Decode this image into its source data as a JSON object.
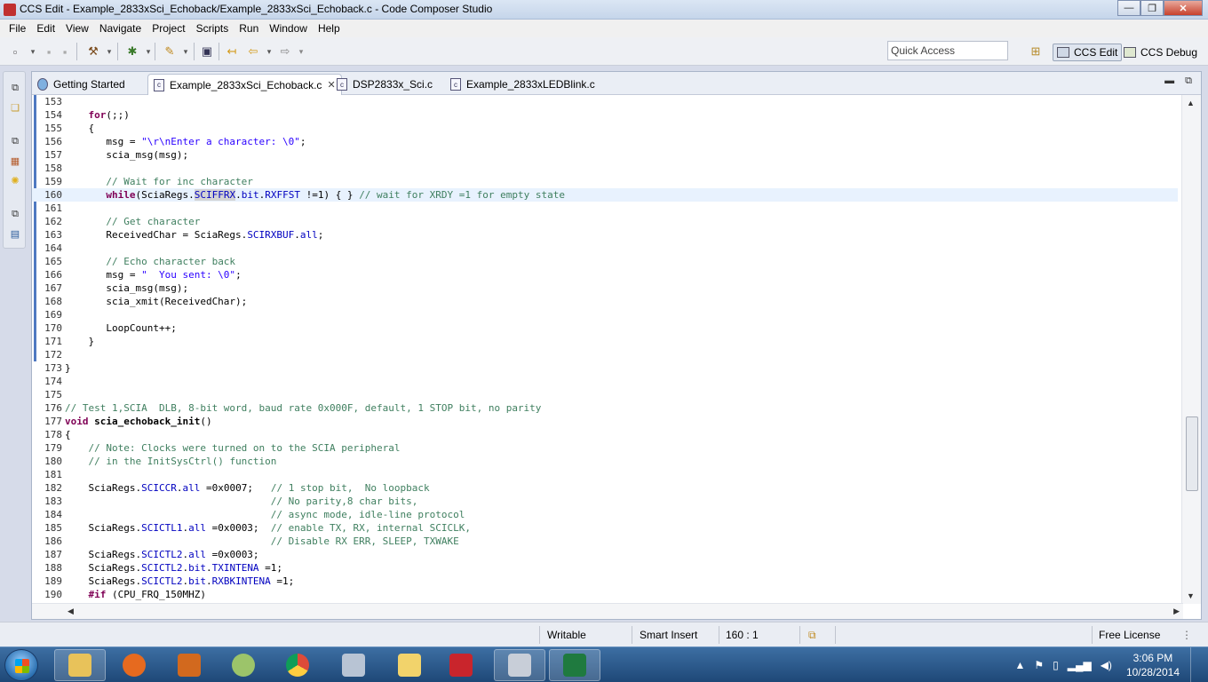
{
  "window": {
    "title": "CCS Edit - Example_2833xSci_Echoback/Example_2833xSci_Echoback.c - Code Composer Studio",
    "minimize": "—",
    "maximize": "❐",
    "close": "✕"
  },
  "menu": [
    "File",
    "Edit",
    "View",
    "Navigate",
    "Project",
    "Scripts",
    "Run",
    "Window",
    "Help"
  ],
  "toolbar": {
    "quick_access_placeholder": "Quick Access",
    "perspectives": [
      {
        "label": "CCS Edit",
        "active": true
      },
      {
        "label": "CCS Debug",
        "active": false
      }
    ]
  },
  "editor": {
    "tabs": [
      {
        "label": "Getting Started",
        "icon": "globe-icon",
        "active": false
      },
      {
        "label": "Example_2833xSci_Echoback.c",
        "icon": "c-file-icon",
        "active": true,
        "closable": true
      },
      {
        "label": "DSP2833x_Sci.c",
        "icon": "c-file-icon",
        "active": false
      },
      {
        "label": "Example_2833xLEDBlink.c",
        "icon": "c-file-icon",
        "active": false
      }
    ],
    "current_line": 160,
    "lines": [
      {
        "n": "153",
        "segs": [
          [
            "",
            ""
          ]
        ]
      },
      {
        "n": "154",
        "segs": [
          [
            "",
            "    "
          ],
          [
            "kw",
            "for"
          ],
          [
            "",
            "(;;)"
          ]
        ]
      },
      {
        "n": "155",
        "segs": [
          [
            "",
            "    {"
          ]
        ]
      },
      {
        "n": "156",
        "segs": [
          [
            "",
            "       msg = "
          ],
          [
            "st",
            "\"\\r\\nEnter a character: \\0\""
          ],
          [
            "",
            ";"
          ]
        ]
      },
      {
        "n": "157",
        "segs": [
          [
            "",
            "       scia_msg(msg);"
          ]
        ]
      },
      {
        "n": "158",
        "segs": [
          [
            "",
            ""
          ]
        ]
      },
      {
        "n": "159",
        "segs": [
          [
            "",
            "       "
          ],
          [
            "cm",
            "// Wait for inc character"
          ]
        ]
      },
      {
        "n": "160",
        "segs": [
          [
            "",
            "       "
          ],
          [
            "kw",
            "while"
          ],
          [
            "",
            "(SciaRegs."
          ],
          [
            "fd hl",
            "SCIFFRX"
          ],
          [
            "",
            "."
          ],
          [
            "fd",
            "bit"
          ],
          [
            "",
            "."
          ],
          [
            "fd",
            "RXFFST"
          ],
          [
            "",
            " !=1) { } "
          ],
          [
            "cm",
            "// wait for XRDY =1 for empty state"
          ]
        ]
      },
      {
        "n": "161",
        "segs": [
          [
            "",
            ""
          ]
        ]
      },
      {
        "n": "162",
        "segs": [
          [
            "",
            "       "
          ],
          [
            "cm",
            "// Get character"
          ]
        ]
      },
      {
        "n": "163",
        "segs": [
          [
            "",
            "       ReceivedChar = SciaRegs."
          ],
          [
            "fd",
            "SCIRXBUF"
          ],
          [
            "",
            "."
          ],
          [
            "fd",
            "all"
          ],
          [
            "",
            ";"
          ]
        ]
      },
      {
        "n": "164",
        "segs": [
          [
            "",
            ""
          ]
        ]
      },
      {
        "n": "165",
        "segs": [
          [
            "",
            "       "
          ],
          [
            "cm",
            "// Echo character back"
          ]
        ]
      },
      {
        "n": "166",
        "segs": [
          [
            "",
            "       msg = "
          ],
          [
            "st",
            "\"  You sent: \\0\""
          ],
          [
            "",
            ";"
          ]
        ]
      },
      {
        "n": "167",
        "segs": [
          [
            "",
            "       scia_msg(msg);"
          ]
        ]
      },
      {
        "n": "168",
        "segs": [
          [
            "",
            "       scia_xmit(ReceivedChar);"
          ]
        ]
      },
      {
        "n": "169",
        "segs": [
          [
            "",
            ""
          ]
        ]
      },
      {
        "n": "170",
        "segs": [
          [
            "",
            "       LoopCount++;"
          ]
        ]
      },
      {
        "n": "171",
        "segs": [
          [
            "",
            "    }"
          ]
        ]
      },
      {
        "n": "172",
        "segs": [
          [
            "",
            ""
          ]
        ]
      },
      {
        "n": "173",
        "segs": [
          [
            "",
            "}"
          ]
        ]
      },
      {
        "n": "174",
        "segs": [
          [
            "",
            ""
          ]
        ]
      },
      {
        "n": "175",
        "segs": [
          [
            "",
            ""
          ]
        ]
      },
      {
        "n": "176",
        "segs": [
          [
            "cm",
            "// Test 1,SCIA  DLB, 8-bit word, baud rate 0x000F, default, 1 STOP bit, no parity"
          ]
        ]
      },
      {
        "n": "177",
        "segs": [
          [
            "kw",
            "void"
          ],
          [
            "",
            " "
          ],
          [
            "fn-b",
            "scia_echoback_init"
          ],
          [
            "",
            "()"
          ]
        ]
      },
      {
        "n": "178",
        "segs": [
          [
            "",
            "{"
          ]
        ]
      },
      {
        "n": "179",
        "segs": [
          [
            "",
            "    "
          ],
          [
            "cm",
            "// Note: Clocks were turned on to the SCIA peripheral"
          ]
        ]
      },
      {
        "n": "180",
        "segs": [
          [
            "",
            "    "
          ],
          [
            "cm",
            "// in the InitSysCtrl() function"
          ]
        ]
      },
      {
        "n": "181",
        "segs": [
          [
            "",
            ""
          ]
        ]
      },
      {
        "n": "182",
        "segs": [
          [
            "",
            "    SciaRegs."
          ],
          [
            "fd",
            "SCICCR"
          ],
          [
            "",
            "."
          ],
          [
            "fd",
            "all"
          ],
          [
            "",
            " =0x0007;   "
          ],
          [
            "cm",
            "// 1 stop bit,  No loopback"
          ]
        ]
      },
      {
        "n": "183",
        "segs": [
          [
            "",
            "                                   "
          ],
          [
            "cm",
            "// No parity,8 char bits,"
          ]
        ]
      },
      {
        "n": "184",
        "segs": [
          [
            "",
            "                                   "
          ],
          [
            "cm",
            "// async mode, idle-line protocol"
          ]
        ]
      },
      {
        "n": "185",
        "segs": [
          [
            "",
            "    SciaRegs."
          ],
          [
            "fd",
            "SCICTL1"
          ],
          [
            "",
            "."
          ],
          [
            "fd",
            "all"
          ],
          [
            "",
            " =0x0003;  "
          ],
          [
            "cm",
            "// enable TX, RX, internal SCICLK,"
          ]
        ]
      },
      {
        "n": "186",
        "segs": [
          [
            "",
            "                                   "
          ],
          [
            "cm",
            "// Disable RX ERR, SLEEP, TXWAKE"
          ]
        ]
      },
      {
        "n": "187",
        "segs": [
          [
            "",
            "    SciaRegs."
          ],
          [
            "fd",
            "SCICTL2"
          ],
          [
            "",
            "."
          ],
          [
            "fd",
            "all"
          ],
          [
            "",
            " =0x0003;"
          ]
        ]
      },
      {
        "n": "188",
        "segs": [
          [
            "",
            "    SciaRegs."
          ],
          [
            "fd",
            "SCICTL2"
          ],
          [
            "",
            "."
          ],
          [
            "fd",
            "bit"
          ],
          [
            "",
            "."
          ],
          [
            "fd",
            "TXINTENA"
          ],
          [
            "",
            " =1;"
          ]
        ]
      },
      {
        "n": "189",
        "segs": [
          [
            "",
            "    SciaRegs."
          ],
          [
            "fd",
            "SCICTL2"
          ],
          [
            "",
            "."
          ],
          [
            "fd",
            "bit"
          ],
          [
            "",
            "."
          ],
          [
            "fd",
            "RXBKINTENA"
          ],
          [
            "",
            " =1;"
          ]
        ]
      },
      {
        "n": "190",
        "segs": [
          [
            "",
            "    "
          ],
          [
            "kw",
            "#if"
          ],
          [
            "",
            " (CPU_FRQ_150MHZ)"
          ]
        ]
      }
    ]
  },
  "status": {
    "mode": "Writable",
    "insert": "Smart Insert",
    "position": "160 : 1",
    "license": "Free License"
  },
  "taskbar": {
    "apps": [
      {
        "name": "explorer-icon",
        "color": "#e8c25a"
      },
      {
        "name": "firefox-icon",
        "color": "#e66a1f"
      },
      {
        "name": "matlab-icon",
        "color": "#d2691e"
      },
      {
        "name": "eyes-icon",
        "color": "#9cc46a"
      },
      {
        "name": "chrome-icon",
        "color": "#dd4b39"
      },
      {
        "name": "cube-icon",
        "color": "#b8c4d4"
      },
      {
        "name": "folder-notes-icon",
        "color": "#f2d36b"
      },
      {
        "name": "pdf-icon",
        "color": "#c9252c"
      },
      {
        "name": "ccs-cube-icon",
        "color": "#c8ced8"
      },
      {
        "name": "excel-icon",
        "color": "#1f7a3f"
      }
    ],
    "time": "3:06 PM",
    "date": "10/28/2014"
  }
}
